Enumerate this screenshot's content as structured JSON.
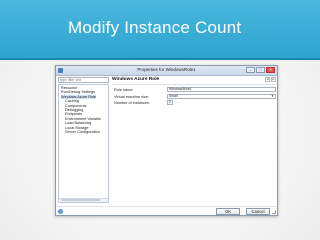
{
  "slide": {
    "title": "Modify Instance Count"
  },
  "dialog": {
    "title": "Properties for WindowsRole1",
    "window_buttons": {
      "minimize": "–",
      "maximize": "□",
      "close": "✕"
    },
    "filter_placeholder": "type filter text",
    "tree": [
      {
        "label": "Resource",
        "indent": 0,
        "selected": false
      },
      {
        "label": "Run/Debug Settings",
        "indent": 0,
        "selected": false
      },
      {
        "label": "Windows Azure Role",
        "indent": 0,
        "selected": true
      },
      {
        "label": "Caching",
        "indent": 1,
        "selected": false
      },
      {
        "label": "Components",
        "indent": 1,
        "selected": false
      },
      {
        "label": "Debugging",
        "indent": 1,
        "selected": false
      },
      {
        "label": "Endpoints",
        "indent": 1,
        "selected": false
      },
      {
        "label": "Environment Variable",
        "indent": 1,
        "selected": false
      },
      {
        "label": "Load Balancing",
        "indent": 1,
        "selected": false
      },
      {
        "label": "Local Storage",
        "indent": 1,
        "selected": false
      },
      {
        "label": "Server Configuration",
        "indent": 1,
        "selected": false
      }
    ],
    "section_title": "Windows Azure Role",
    "nav": {
      "back": "◂",
      "forward": "▸"
    },
    "fields": {
      "role_name": {
        "label": "Role name:",
        "value": "WindowsRole1"
      },
      "vm_size": {
        "label": "Virtual machine size:",
        "value": "Small"
      },
      "instances": {
        "label": "Number of instances:",
        "value": "2"
      }
    },
    "help": "?",
    "ok_label": "OK",
    "cancel_label": "Cancel"
  }
}
